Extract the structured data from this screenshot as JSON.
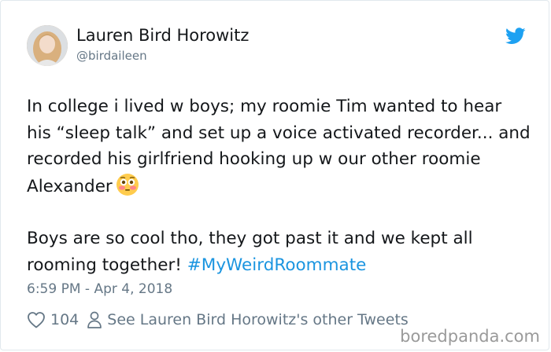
{
  "author": {
    "name": "Lauren Bird Horowitz",
    "handle": "@birdaileen"
  },
  "tweet": {
    "paragraph1": "In college i lived w boys; my roomie Tim wanted to hear his “sleep talk” and set up a voice activated recorder... and recorded his girlfriend hooking up w our other roomie Alexander",
    "paragraph1_emoji": "flushed-face-emoji",
    "paragraph2_text": "Boys are so cool tho, they got past it and we kept all rooming together! ",
    "hashtag": "#MyWeirdRoommate",
    "timestamp": "6:59 PM - Apr 4, 2018"
  },
  "footer": {
    "like_count": "104",
    "like_icon": "heart-icon",
    "profile_icon": "person-icon",
    "see_more_label": "See Lauren Bird Horowitz's other Tweets"
  },
  "watermark": "boredpanda.com",
  "colors": {
    "text": "#14171a",
    "muted": "#657786",
    "link": "#1b95e0",
    "twitter_blue": "#1da1f2"
  }
}
